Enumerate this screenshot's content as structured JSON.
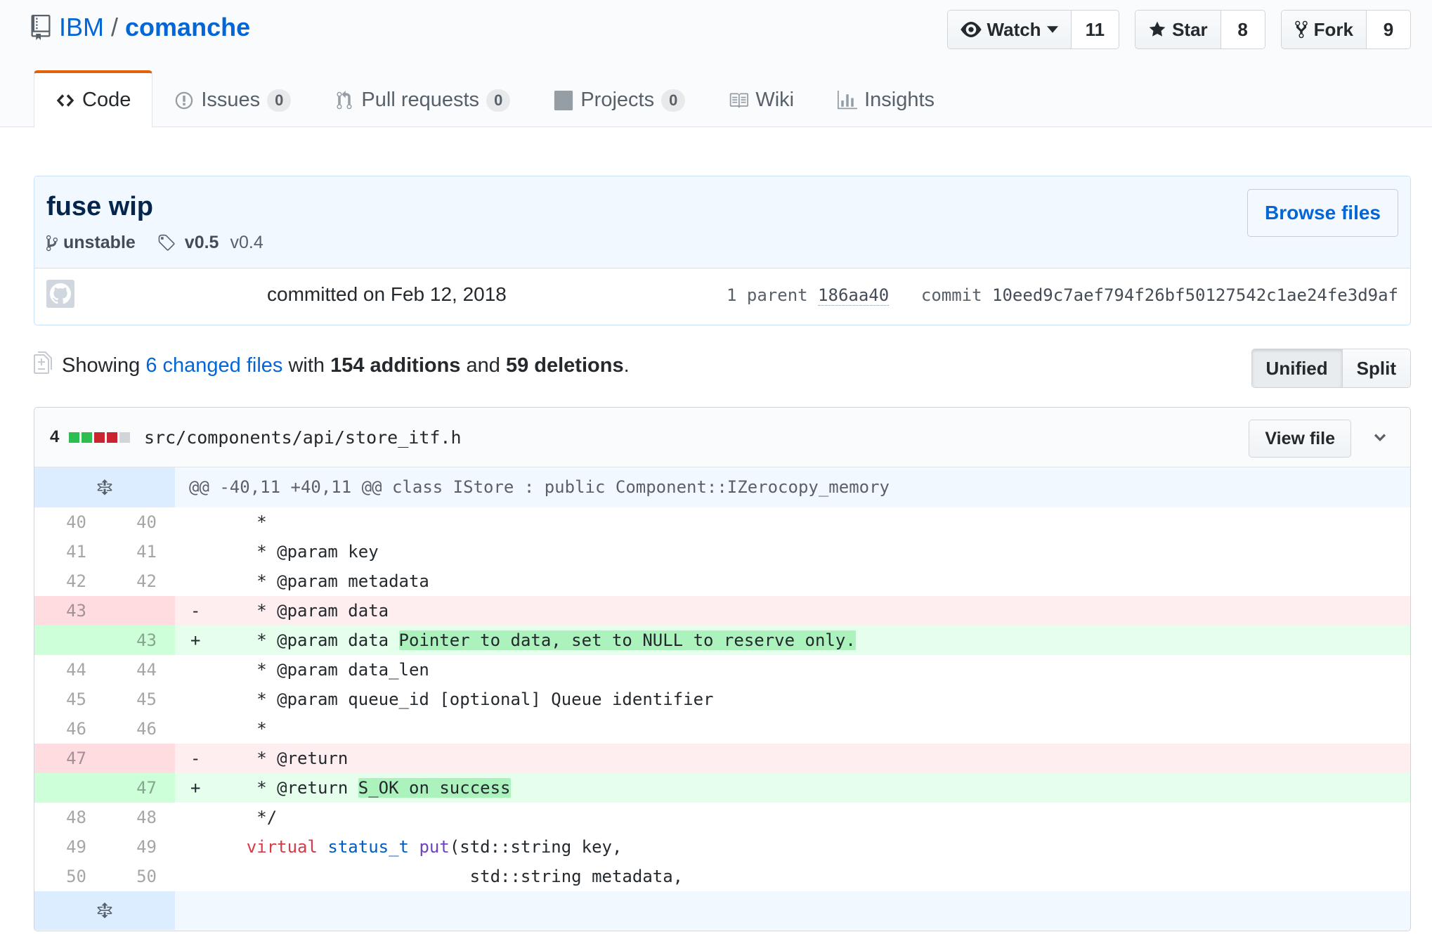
{
  "repo": {
    "owner": "IBM",
    "separator": "/",
    "name": "comanche"
  },
  "actions": [
    {
      "label": "Watch",
      "icon": "eye-icon",
      "count": "11"
    },
    {
      "label": "Star",
      "icon": "star-icon",
      "count": "8"
    },
    {
      "label": "Fork",
      "icon": "fork-icon",
      "count": "9"
    }
  ],
  "nav": [
    {
      "label": "Code",
      "icon": "code-icon",
      "selected": true
    },
    {
      "label": "Issues",
      "icon": "issue-icon",
      "counter": "0"
    },
    {
      "label": "Pull requests",
      "icon": "pull-request-icon",
      "counter": "0"
    },
    {
      "label": "Projects",
      "icon": "project-icon",
      "counter": "0"
    },
    {
      "label": "Wiki",
      "icon": "book-icon"
    },
    {
      "label": "Insights",
      "icon": "graph-icon"
    }
  ],
  "commit": {
    "title": "fuse wip",
    "branch": "unstable",
    "tag_primary": "v0.5",
    "tag_secondary": "v0.4",
    "browse_label": "Browse files",
    "committed": "committed on Feb 12, 2018",
    "parent_label": "1 parent",
    "parent_sha": "186aa40",
    "commit_label": "commit",
    "commit_sha": "10eed9c7aef794f26bf50127542c1ae24fe3d9af"
  },
  "toc": {
    "showing": "Showing",
    "changed": "6 changed files",
    "with": "with",
    "additions": "154 additions",
    "and": "and",
    "deletions": "59 deletions",
    "period": ".",
    "unified": "Unified",
    "split": "Split"
  },
  "file": {
    "changes": "4",
    "diffstat_colors": [
      "#2cbe4e",
      "#2cbe4e",
      "#cb2431",
      "#cb2431",
      "#d1d5da"
    ],
    "path": "src/components/api/store_itf.h",
    "view_label": "View file",
    "hunk": "@@ -40,11 +40,11 @@ class IStore : public Component::IZerocopy_memory",
    "lines": [
      {
        "type": "ctx",
        "old": "40",
        "new": "40",
        "marker": "",
        "code": "     *"
      },
      {
        "type": "ctx",
        "old": "41",
        "new": "41",
        "marker": "",
        "code": "     * @param key"
      },
      {
        "type": "ctx",
        "old": "42",
        "new": "42",
        "marker": "",
        "code": "     * @param metadata"
      },
      {
        "type": "del",
        "old": "43",
        "new": "",
        "marker": "-",
        "code": "     * @param data"
      },
      {
        "type": "add",
        "old": "",
        "new": "43",
        "marker": "+",
        "code": "     * @param data ",
        "hl": "Pointer to data, set to NULL to reserve only."
      },
      {
        "type": "ctx",
        "old": "44",
        "new": "44",
        "marker": "",
        "code": "     * @param data_len"
      },
      {
        "type": "ctx",
        "old": "45",
        "new": "45",
        "marker": "",
        "code": "     * @param queue_id [optional] Queue identifier"
      },
      {
        "type": "ctx",
        "old": "46",
        "new": "46",
        "marker": "",
        "code": "     *"
      },
      {
        "type": "del",
        "old": "47",
        "new": "",
        "marker": "-",
        "code": "     * @return"
      },
      {
        "type": "add",
        "old": "",
        "new": "47",
        "marker": "+",
        "code": "     * @return ",
        "hl": "S_OK on success"
      },
      {
        "type": "ctx",
        "old": "48",
        "new": "48",
        "marker": "",
        "code": "     */"
      },
      {
        "type": "sig",
        "old": "49",
        "new": "49",
        "marker": "",
        "code": ""
      },
      {
        "type": "ctx",
        "old": "50",
        "new": "50",
        "marker": "",
        "code": "                          std::string metadata,"
      }
    ],
    "sig_parts": {
      "indent": "    ",
      "kw": "virtual",
      "type": "status_t",
      "fn": "put",
      "rest": "(std::string key,"
    }
  }
}
